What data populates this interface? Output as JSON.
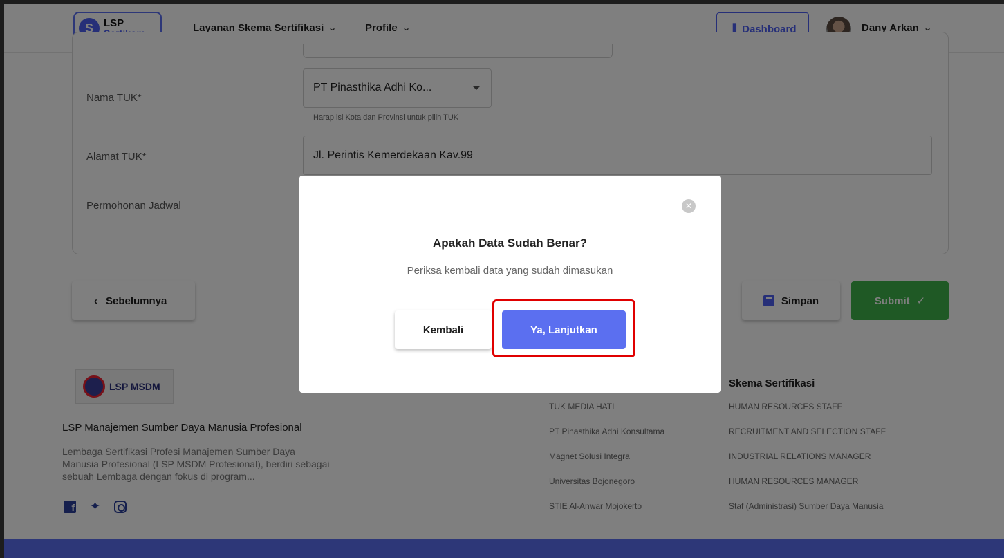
{
  "header": {
    "logo_line1": "LSP",
    "logo_line2": "Sertikom.",
    "logo_mark": "S",
    "nav": [
      {
        "label": "Layanan Skema Sertifikasi"
      },
      {
        "label": "Profile"
      }
    ],
    "dashboard_label": "Dashboard",
    "user_name": "Dany Arkan"
  },
  "form": {
    "tuk_label": "Nama TUK*",
    "tuk_value": "PT Pinasthika Adhi Ko...",
    "tuk_helper": "Harap isi Kota dan Provinsi untuk pilih TUK",
    "alamat_label": "Alamat TUK*",
    "alamat_value": "Jl. Perintis Kemerdekaan Kav.99",
    "jadwal_label": "Permohonan Jadwal"
  },
  "actions": {
    "prev_label": "Sebelumnya",
    "save_label": "Simpan",
    "submit_label": "Submit"
  },
  "footer": {
    "logo_text": "LSP MSDM",
    "org_name": "LSP Manajemen Sumber Daya Manusia Profesional",
    "description": "Lembaga Sertifikasi Profesi Manajemen Sumber Daya Manusia Profesional (LSP MSDM Profesional), berdiri sebagai sebuah Lembaga dengan fokus di program...",
    "tuk_items": [
      "TUK MEDIA HATI",
      "PT Pinasthika Adhi Konsultama",
      "Magnet Solusi Integra",
      "Universitas Bojonegoro",
      "STIE Al-Anwar Mojokerto"
    ],
    "skema_heading": "Skema Sertifikasi",
    "skema_items": [
      "HUMAN RESOURCES STAFF",
      "RECRUITMENT AND SELECTION STAFF",
      "INDUSTRIAL RELATIONS MANAGER",
      "HUMAN RESOURCES MANAGER",
      "Staf (Administrasi) Sumber Daya Manusia"
    ]
  },
  "modal": {
    "title": "Apakah Data Sudah Benar?",
    "subtitle": "Periksa kembali data yang sudah dimasukan",
    "back_label": "Kembali",
    "confirm_label": "Ya, Lanjutkan"
  },
  "colors": {
    "accent": "#5b6ff0",
    "submit": "#3fb34a",
    "highlight": "#e00000"
  }
}
